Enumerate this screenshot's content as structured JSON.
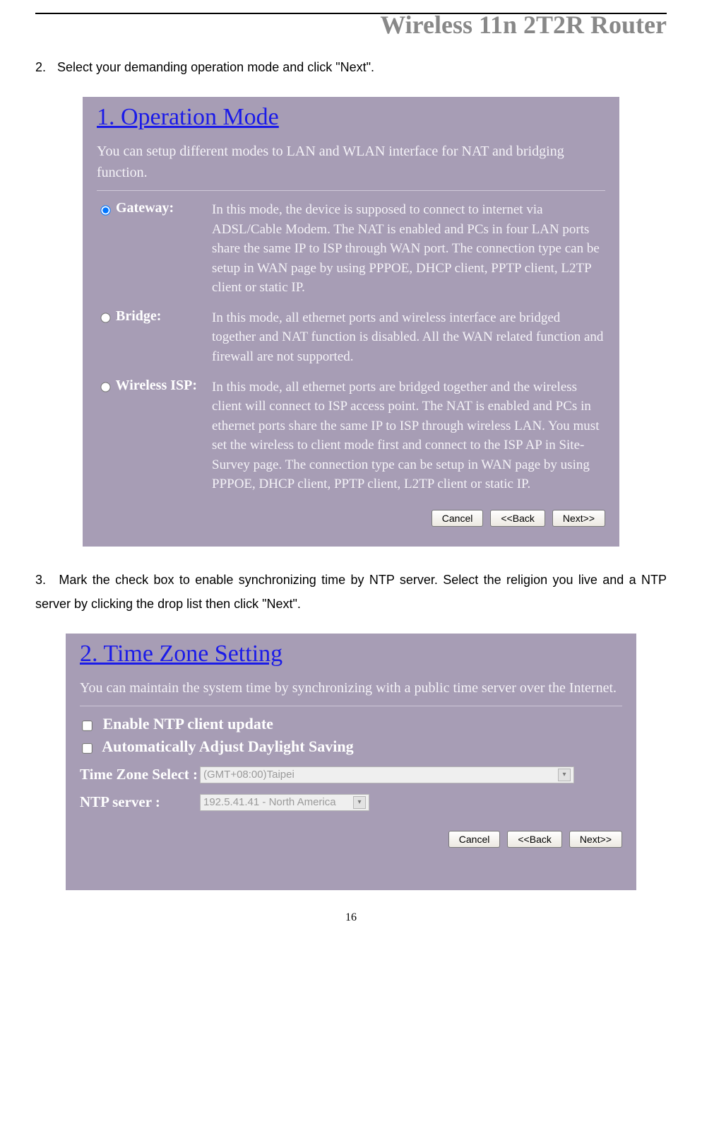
{
  "doc_header": "Wireless 11n 2T2R Router",
  "step2": {
    "num": "2.",
    "text": "Select your demanding operation mode and click \"Next\"."
  },
  "shot1": {
    "title": "1. Operation Mode",
    "intro": "You can setup different modes to LAN and WLAN interface for NAT and bridging function.",
    "options": [
      {
        "label": "Gateway:",
        "checked": true,
        "desc": "In this mode, the device is supposed to connect to internet via ADSL/Cable Modem. The NAT is enabled and PCs in four LAN ports share the same IP to ISP through WAN port. The connection type can be setup in WAN page by using PPPOE, DHCP client, PPTP client, L2TP client or static IP."
      },
      {
        "label": "Bridge:",
        "checked": false,
        "desc": "In this mode, all ethernet ports and wireless interface are bridged together and NAT function is disabled. All the WAN related function and firewall are not supported."
      },
      {
        "label": "Wireless ISP:",
        "checked": false,
        "desc": "In this mode, all ethernet ports are bridged together and the wireless client will connect to ISP access point. The NAT is enabled and PCs in ethernet ports share the same IP to ISP through wireless LAN. You must set the wireless to client mode first and connect to the ISP AP in Site-Survey page. The connection type can be setup in WAN page by using PPPOE, DHCP client, PPTP client, L2TP client or static IP."
      }
    ],
    "buttons": {
      "cancel": "Cancel",
      "back": "<<Back",
      "next": "Next>>"
    }
  },
  "step3": {
    "num": "3.",
    "text": "Mark the check box to enable synchronizing time by NTP server. Select the religion you live and a NTP server by clicking the drop list then click \"Next\"."
  },
  "shot2": {
    "title": "2. Time Zone Setting",
    "intro": "You can maintain the system time by synchronizing with a public time server over the Internet.",
    "checks": [
      {
        "label": "Enable NTP client update",
        "checked": false
      },
      {
        "label": "Automatically Adjust Daylight Saving",
        "checked": false
      }
    ],
    "fields": {
      "tz_label": "Time Zone Select :",
      "tz_value": "(GMT+08:00)Taipei",
      "ntp_label": "NTP server :",
      "ntp_value": "192.5.41.41 - North America"
    },
    "buttons": {
      "cancel": "Cancel",
      "back": "<<Back",
      "next": "Next>>"
    }
  },
  "page_number": "16"
}
